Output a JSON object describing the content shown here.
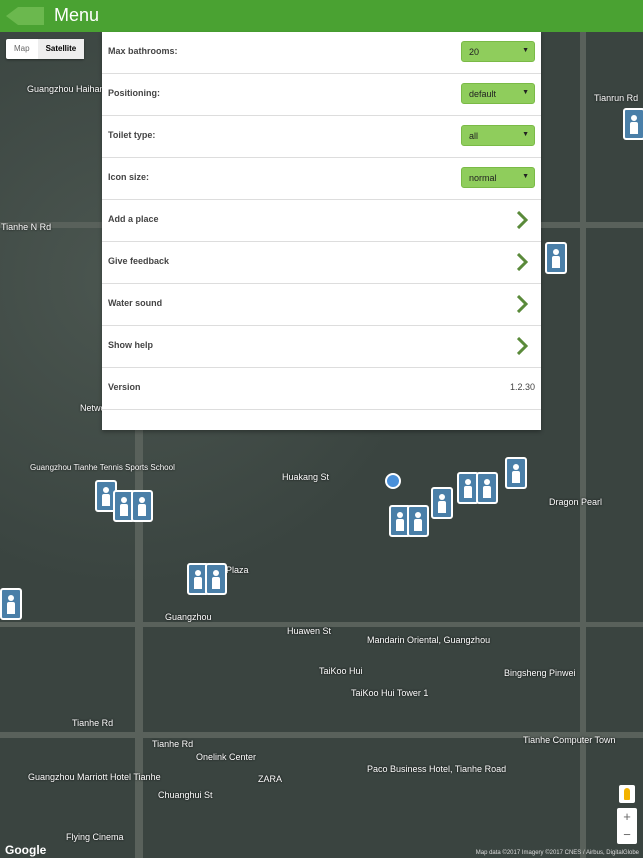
{
  "header": {
    "title": "Menu"
  },
  "map_type": {
    "map_label": "Map",
    "satellite_label": "Satellite"
  },
  "menu": {
    "rows": [
      {
        "label": "Max bathrooms:",
        "value": "20"
      },
      {
        "label": "Positioning:",
        "value": "default"
      },
      {
        "label": "Toilet type:",
        "value": "all"
      },
      {
        "label": "Icon size:",
        "value": "normal"
      }
    ],
    "links": [
      {
        "label": "Add a place"
      },
      {
        "label": "Give feedback"
      },
      {
        "label": "Water sound"
      },
      {
        "label": "Show help"
      }
    ],
    "version_label": "Version",
    "version_value": "1.2.30"
  },
  "map_labels": [
    "Guangzhou Haihang Westin Hotel",
    "Tianhe N Rd",
    "Tianrun Rd",
    "Huakang St",
    "Guangzhou Tianhe Tennis Sports School",
    "Plaza",
    "Guangzhou",
    "Huawen St",
    "Mandarin Oriental, Guangzhou",
    "Bingsheng Pinwei",
    "TaiKoo Hui",
    "TaiKoo Hui Tower 1",
    "Tianhe Rd",
    "Onelink Center",
    "ZARA",
    "Chuanghui St",
    "Paco Business Hotel, Tianhe Road",
    "Tianhe Computer Town",
    "Guangzhou Marriott Hotel Tianhe",
    "Flying Cinema",
    "Dragon Pearl",
    "Tianhe Rd",
    "Network"
  ],
  "google_logo": "Google",
  "attribution": "Map data ©2017 Imagery ©2017 CNES / Airbus, DigitalGlobe",
  "zoom": {
    "in": "+",
    "out": "−"
  },
  "colors": {
    "header": "#4aa232",
    "select": "#8fcd5c",
    "chevron": "#5a8a3a",
    "pin": "#4a7fa8"
  }
}
